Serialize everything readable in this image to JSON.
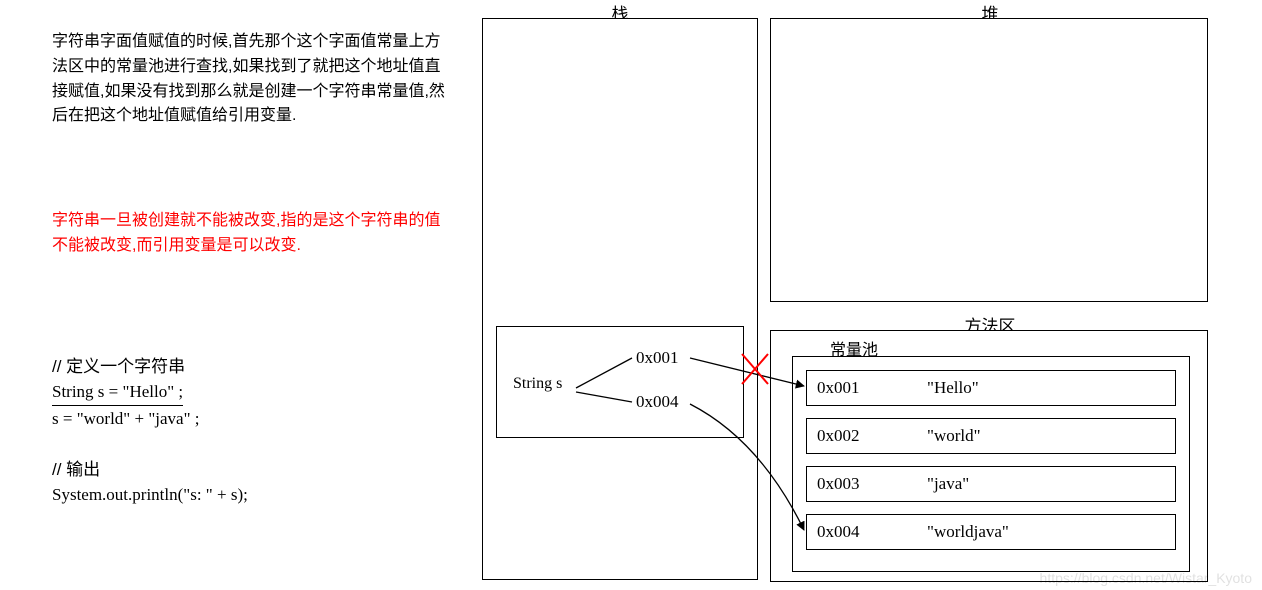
{
  "paragraph1": "字符串字面值赋值的时候,首先那个这个字面值常量上方法区中的常量池进行查找,如果找到了就把这个地址值直接赋值,如果没有找到那么就是创建一个字符串常量值,然后在把这个地址值赋值给引用变量.",
  "paragraph2": "字符串一旦被创建就不能被改变,指的是这个字符串的值不能被改变,而引用变量是可以改变.",
  "code": {
    "c1": "// 定义一个字符串",
    "l1": "String s = \"Hello\" ;",
    "l2": "s = \"world\" + \"java\" ;",
    "c2": "// 输出",
    "l3": "System.out.println(\"s: \" + s);"
  },
  "labels": {
    "stack": "栈",
    "heap": "堆",
    "method_area": "方法区",
    "constant_pool": "常量池"
  },
  "frame": {
    "var": "String s",
    "addr_old": "0x001",
    "addr_new": "0x004"
  },
  "pool": {
    "r1": {
      "addr": "0x001",
      "val": "\"Hello\""
    },
    "r2": {
      "addr": "0x002",
      "val": "\"world\""
    },
    "r3": {
      "addr": "0x003",
      "val": "\"java\""
    },
    "r4": {
      "addr": "0x004",
      "val": "\"worldjava\""
    }
  },
  "watermark": "https://blog.csdn.net/Wistar_Kyoto"
}
